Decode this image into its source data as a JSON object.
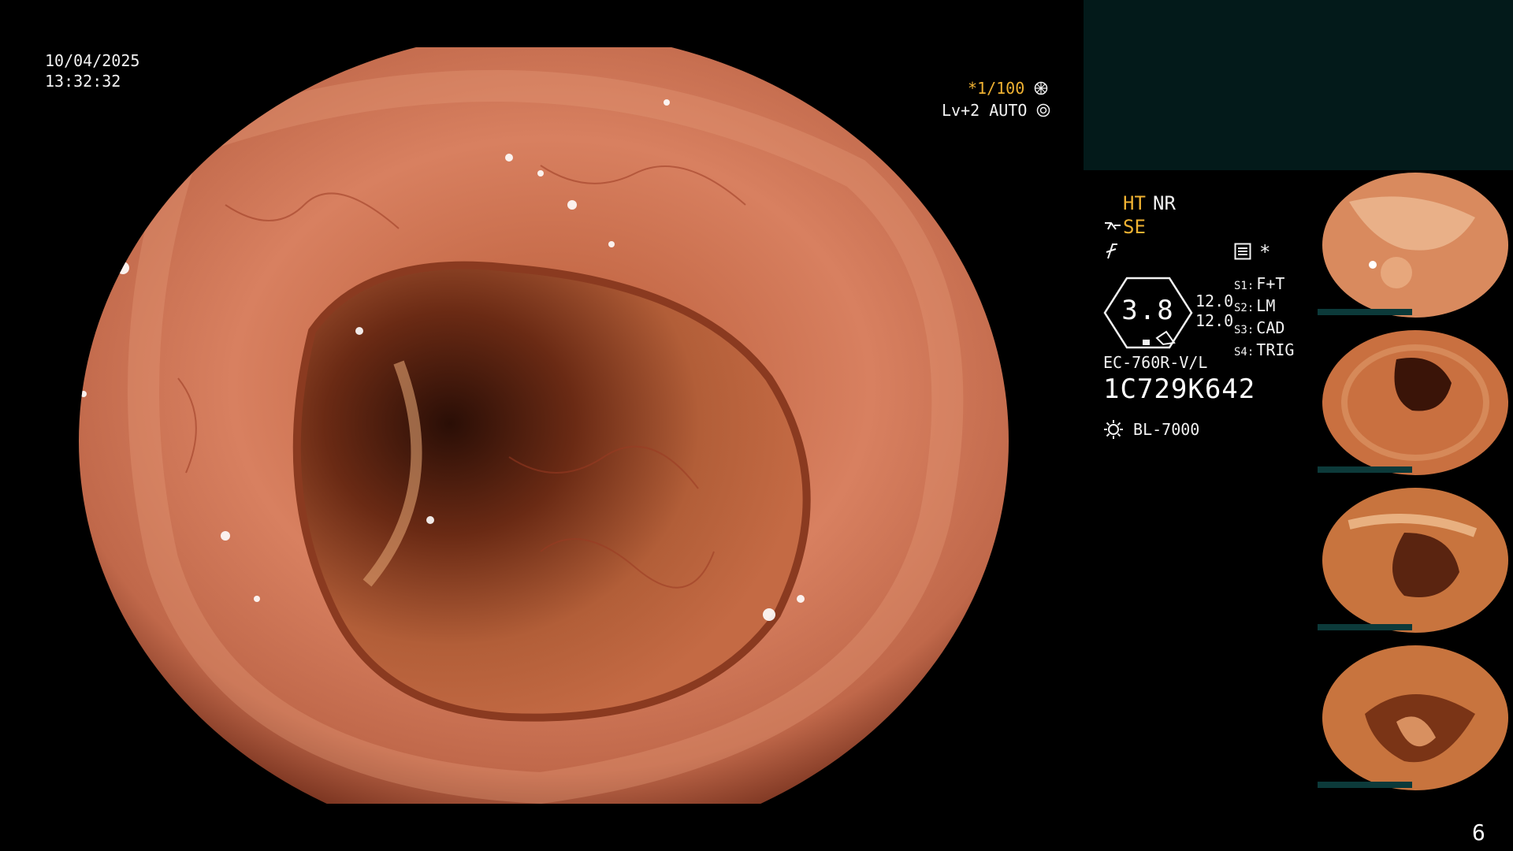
{
  "overlay": {
    "date": "10/04/2025",
    "time": "13:32:32",
    "shutter": "*1/100",
    "level": "Lv+2 AUTO"
  },
  "panel": {
    "mode_ht": "HT",
    "mode_nr": "NR",
    "mode_se": "SE",
    "asterisk": "*",
    "gauge_value": "3.8",
    "gauge_line1": "12.0",
    "gauge_line2": "12.0",
    "switches": [
      {
        "label": "S1:",
        "value": "F+T"
      },
      {
        "label": "S2:",
        "value": "LM"
      },
      {
        "label": "S3:",
        "value": "CAD"
      },
      {
        "label": "S4:",
        "value": "TRIG"
      }
    ],
    "scope_model": "EC-760R-V/L",
    "scope_serial": "1C729K642",
    "light_source": "BL-7000"
  },
  "page_number": "6",
  "colors": {
    "accent_orange": "#f0b232",
    "panel_teal": "#031a1a",
    "mucosa": "#c86a4a"
  },
  "icons": [
    "shutter-wheel-icon",
    "auto-iris-icon",
    "scope-angle-icon",
    "freeze-icon",
    "record-icon",
    "light-bulb-icon"
  ]
}
